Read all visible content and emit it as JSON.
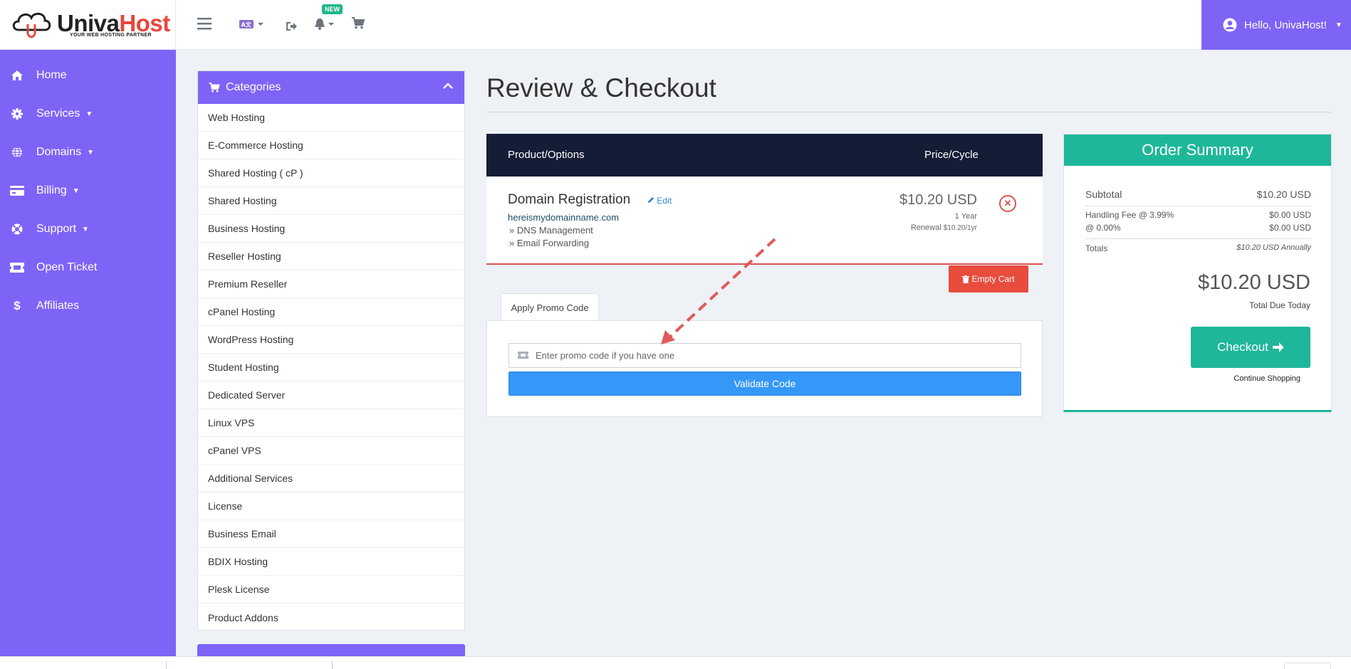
{
  "brand": {
    "name_part1": "Univa",
    "name_part2": "Host",
    "tagline": "YOUR WEB HOSTING PARTNER",
    "accent_color": "#7d64f7",
    "red_color": "#e8453c"
  },
  "topbar": {
    "new_badge": "NEW",
    "user_greeting": "Hello, UnivaHost!",
    "icons": [
      "hamburger-icon",
      "language-icon",
      "logout-icon",
      "bell-icon",
      "cart-icon",
      "user-circle-icon"
    ]
  },
  "sidebar": {
    "items": [
      {
        "label": "Home",
        "icon": "home-icon",
        "has_caret": false
      },
      {
        "label": "Services",
        "icon": "gear-icon",
        "has_caret": true
      },
      {
        "label": "Domains",
        "icon": "globe-icon",
        "has_caret": true
      },
      {
        "label": "Billing",
        "icon": "card-icon",
        "has_caret": true
      },
      {
        "label": "Support",
        "icon": "lifebuoy-icon",
        "has_caret": true
      },
      {
        "label": "Open Ticket",
        "icon": "ticket-icon",
        "has_caret": false
      },
      {
        "label": "Affiliates",
        "icon": "dollar-icon",
        "has_caret": false
      }
    ]
  },
  "categories": {
    "title": "Categories",
    "items": [
      "Web Hosting",
      "E-Commerce Hosting",
      "Shared Hosting ( cP )",
      "Shared Hosting",
      "Business Hosting",
      "Reseller Hosting",
      "Premium Reseller",
      "cPanel Hosting",
      "WordPress Hosting",
      "Student Hosting",
      "Dedicated Server",
      "Linux VPS",
      "cPanel VPS",
      "Additional Services",
      "License",
      "Business Email",
      "BDIX Hosting",
      "Plesk License",
      "Product Addons"
    ]
  },
  "main": {
    "title": "Review & Checkout",
    "table": {
      "col_product": "Product/Options",
      "col_price": "Price/Cycle"
    },
    "item": {
      "name": "Domain Registration",
      "edit_label": "Edit",
      "domain": "hereismydomainname.com",
      "option1": "» DNS Management",
      "option2": "» Email Forwarding",
      "price": "$10.20 USD",
      "cycle": "1 Year",
      "renewal_label": "Renewal",
      "renewal_value": "$10.20/1yr"
    },
    "empty_cart_label": "Empty Cart",
    "promo": {
      "tab_label": "Apply Promo Code",
      "placeholder": "Enter promo code if you have one",
      "validate_label": "Validate Code"
    }
  },
  "summary": {
    "title": "Order Summary",
    "subtotal_label": "Subtotal",
    "subtotal_value": "$10.20 USD",
    "fee1_label": "Handling Fee @ 3.99%",
    "fee1_value": "$0.00 USD",
    "fee2_label": "@ 0.00%",
    "fee2_value": "$0.00 USD",
    "totals_label": "Totals",
    "totals_value": "$10.20 USD Annually",
    "total_due_amount": "$10.20 USD",
    "total_due_label": "Total Due Today",
    "checkout_label": "Checkout",
    "continue_label": "Continue Shopping"
  }
}
